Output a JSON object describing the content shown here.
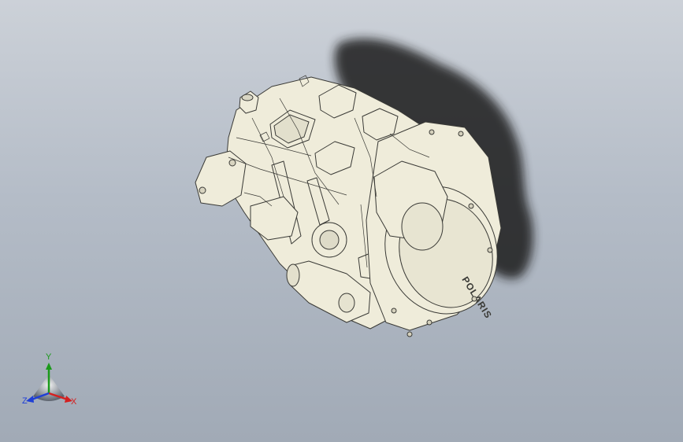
{
  "viewport": {
    "background_top": "#ccd1d8",
    "background_bottom": "#a1aab6"
  },
  "model": {
    "body_color": "#efecda",
    "edge_color": "#3a3a36",
    "shadow_color": "#1c1c1c",
    "cover_text": "POLARIS"
  },
  "triad": {
    "x_label": "X",
    "y_label": "Y",
    "z_label": "Z",
    "x_color": "#d42020",
    "y_color": "#1a9a1a",
    "z_color": "#1f3fd6"
  }
}
